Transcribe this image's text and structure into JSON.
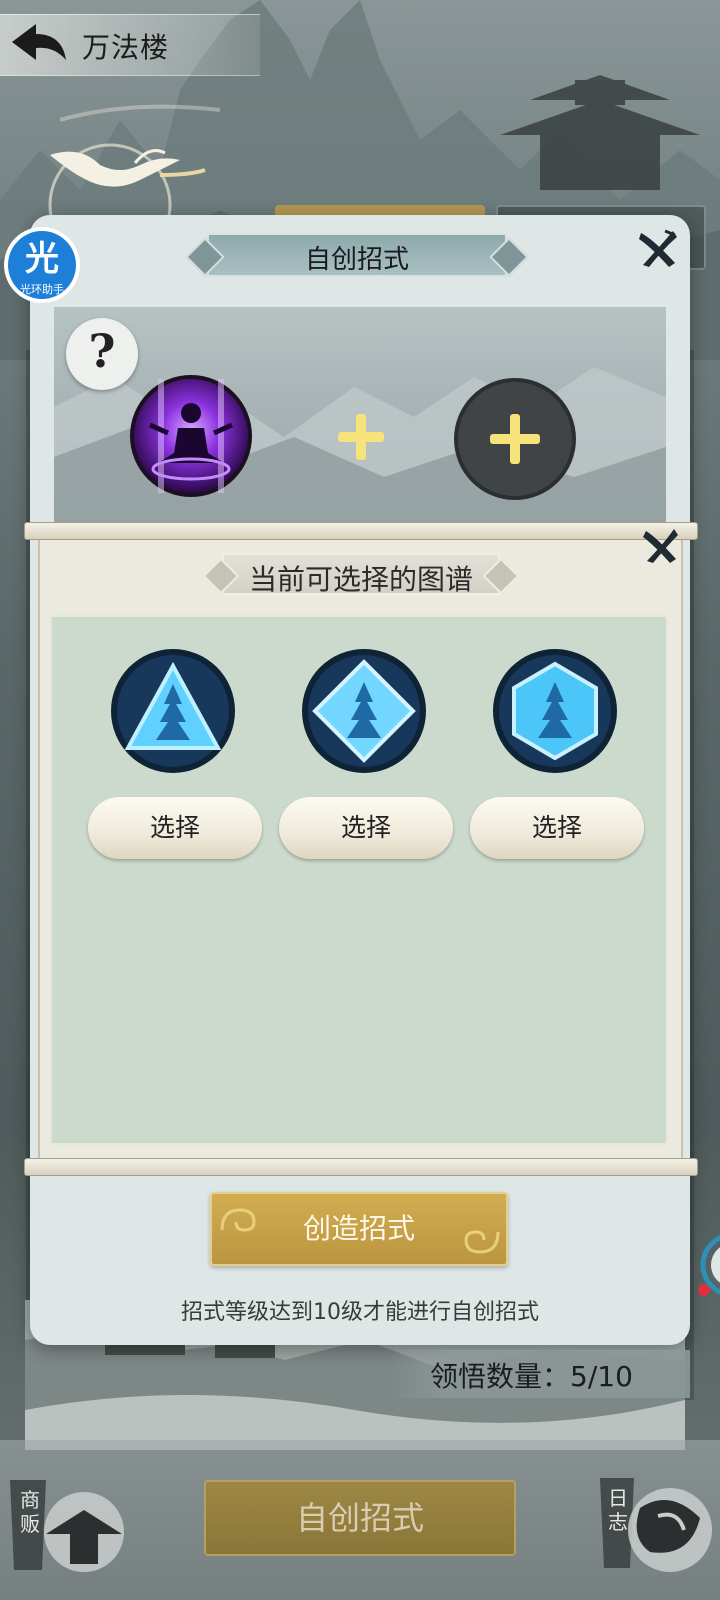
{
  "header": {
    "title": "万法楼"
  },
  "assistant": {
    "badge_char": "光",
    "badge_label": "光环助手"
  },
  "dialog": {
    "title": "自创招式",
    "help_symbol": "?",
    "create_button_label": "创造招式",
    "hint": "招式等级达到10级才能进行自创招式"
  },
  "chart_selector": {
    "title": "当前可选择的图谱",
    "items": [
      {
        "shape": "triangle",
        "select_label": "选择"
      },
      {
        "shape": "diamond",
        "select_label": "选择"
      },
      {
        "shape": "hexagon",
        "select_label": "选择"
      }
    ]
  },
  "comprehension": {
    "label": "领悟数量：5/10"
  },
  "bottom_bar": {
    "main_button_label": "自创招式",
    "merchant_label": "商贩",
    "log_label": "日志"
  },
  "colors": {
    "gold_button": "#c9a34b",
    "dialog_bg": "#dfe6e6",
    "chart_area": "#ccd9cd",
    "purple_skill": "#7a2bd1",
    "blue_chart": "#3fb6e8"
  }
}
